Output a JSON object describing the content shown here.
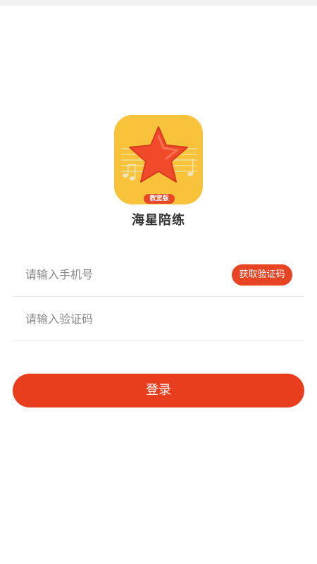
{
  "app": {
    "name": "海星陪练",
    "logo_badge": "教室版"
  },
  "form": {
    "phone_placeholder": "请输入手机号",
    "phone_value": "",
    "code_placeholder": "请输入验证码",
    "code_value": "",
    "get_code_label": "获取验证码",
    "login_label": "登录"
  },
  "icons": {
    "logo": "starfish-music-logo-icon"
  },
  "colors": {
    "accent": "#e83e1e",
    "logo_background": "#f8c23a",
    "star": "#f04a2b"
  }
}
